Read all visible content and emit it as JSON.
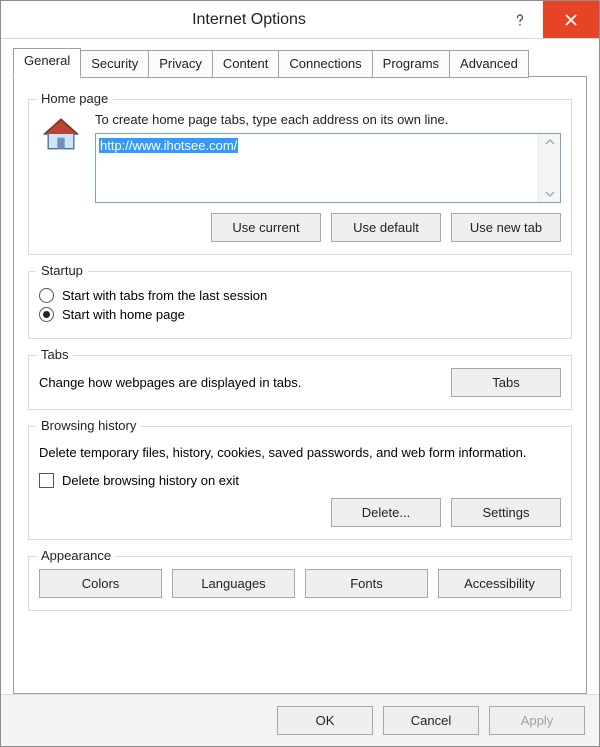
{
  "title": "Internet Options",
  "tabs": [
    "General",
    "Security",
    "Privacy",
    "Content",
    "Connections",
    "Programs",
    "Advanced"
  ],
  "activeTab": 0,
  "homepage": {
    "legend": "Home page",
    "description": "To create home page tabs, type each address on its own line.",
    "url": "http://www.ihotsee.com/",
    "buttons": {
      "useCurrent": "Use current",
      "useDefault": "Use default",
      "useNewTab": "Use new tab"
    }
  },
  "startup": {
    "legend": "Startup",
    "option1": "Start with tabs from the last session",
    "option2": "Start with home page",
    "selected": 2
  },
  "tabsSection": {
    "legend": "Tabs",
    "description": "Change how webpages are displayed in tabs.",
    "button": "Tabs"
  },
  "history": {
    "legend": "Browsing history",
    "description": "Delete temporary files, history, cookies, saved passwords, and web form information.",
    "checkboxLabel": "Delete browsing history on exit",
    "checked": false,
    "deleteBtn": "Delete...",
    "settingsBtn": "Settings"
  },
  "appearance": {
    "legend": "Appearance",
    "colors": "Colors",
    "languages": "Languages",
    "fonts": "Fonts",
    "accessibility": "Accessibility"
  },
  "footer": {
    "ok": "OK",
    "cancel": "Cancel",
    "apply": "Apply"
  }
}
